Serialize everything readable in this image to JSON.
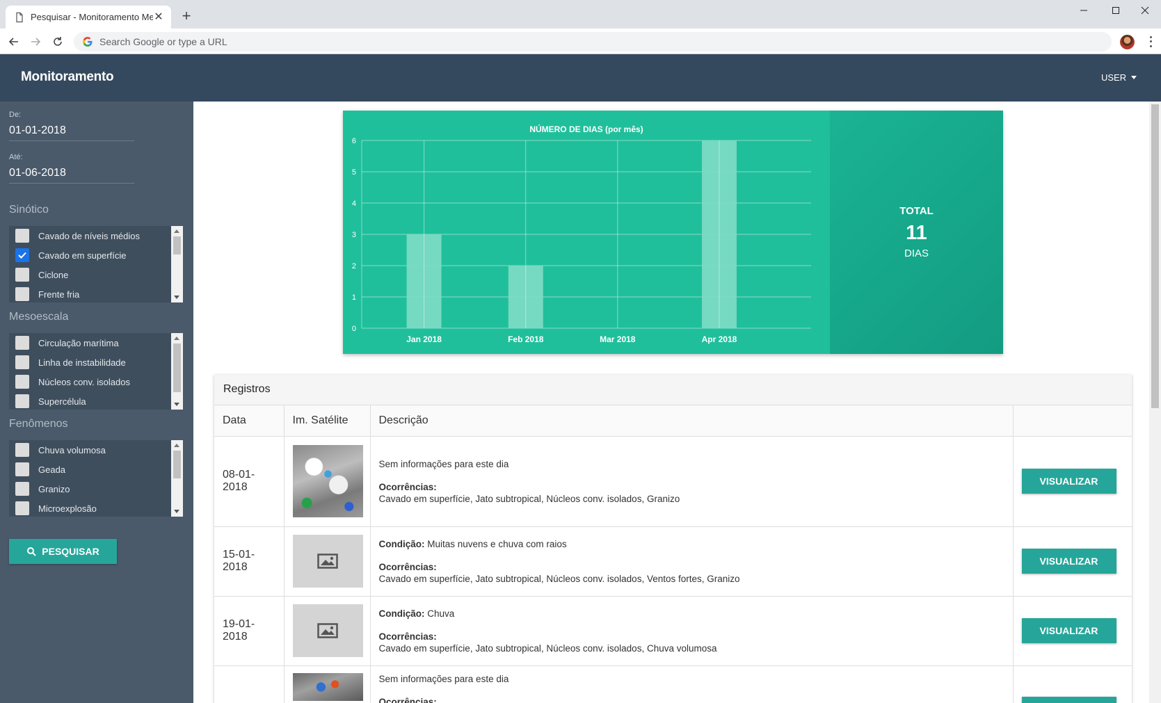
{
  "browser": {
    "tab_title": "Pesquisar - Monitoramento Mete",
    "omnibox_placeholder": "Search Google or type a URL"
  },
  "header": {
    "brand": "Monitoramento",
    "user_menu": "USER"
  },
  "sidebar": {
    "from_label": "De:",
    "from_value": "01-01-2018",
    "to_label": "Até:",
    "to_value": "01-06-2018",
    "sections": [
      {
        "title": "Sinótico",
        "items": [
          {
            "label": "Cavado de níveis médios",
            "checked": false
          },
          {
            "label": "Cavado em superfície",
            "checked": true
          },
          {
            "label": "Ciclone",
            "checked": false
          },
          {
            "label": "Frente fria",
            "checked": false
          }
        ]
      },
      {
        "title": "Mesoescala",
        "items": [
          {
            "label": "Circulação marítima",
            "checked": false
          },
          {
            "label": "Linha de instabilidade",
            "checked": false
          },
          {
            "label": "Núcleos conv. isolados",
            "checked": false
          },
          {
            "label": "Supercélula",
            "checked": false
          }
        ]
      },
      {
        "title": "Fenômenos",
        "items": [
          {
            "label": "Chuva volumosa",
            "checked": false
          },
          {
            "label": "Geada",
            "checked": false
          },
          {
            "label": "Granizo",
            "checked": false
          },
          {
            "label": "Microexplosão",
            "checked": false
          }
        ]
      }
    ],
    "search_button": "PESQUISAR"
  },
  "chart_data": {
    "type": "bar",
    "title": "NÚMERO DE DIAS (por mês)",
    "categories": [
      "Jan 2018",
      "Feb 2018",
      "Mar 2018",
      "Apr 2018"
    ],
    "x_dates": [
      "2018-01-01",
      "2018-02-01",
      "2018-03-01",
      "2018-04-01"
    ],
    "values": [
      3,
      2,
      0,
      6
    ],
    "ylim": [
      0,
      6
    ],
    "y_ticks": [
      0,
      1,
      2,
      3,
      4,
      5,
      6
    ],
    "grid": true,
    "legend": "none",
    "bar_color": "#7fdcc6",
    "bg_color": "#20bf9b"
  },
  "total": {
    "label": "TOTAL",
    "value": "11",
    "unit": "DIAS"
  },
  "records": {
    "title": "Registros",
    "columns": [
      "Data",
      "Im. Satélite",
      "Descrição",
      ""
    ],
    "occurrences_label": "Ocorrências:",
    "condition_label": "Condição:",
    "view_label": "VISUALIZAR",
    "rows": [
      {
        "date": "08-01-2018",
        "image": "satellite",
        "condition": "Sem informações para este dia",
        "occurrences": "Cavado em superfície, Jato subtropical, Núcleos conv. isolados, Granizo"
      },
      {
        "date": "15-01-2018",
        "image": "placeholder",
        "condition": "Muitas nuvens e chuva com raios",
        "occurrences": "Cavado em superfície, Jato subtropical, Núcleos conv. isolados, Ventos fortes, Granizo"
      },
      {
        "date": "19-01-2018",
        "image": "placeholder",
        "condition": "Chuva",
        "occurrences": "Cavado em superfície, Jato subtropical, Núcleos conv. isolados, Chuva volumosa"
      },
      {
        "date": "",
        "image": "satellite",
        "condition": "Sem informações para este dia",
        "occurrences": ""
      }
    ]
  }
}
